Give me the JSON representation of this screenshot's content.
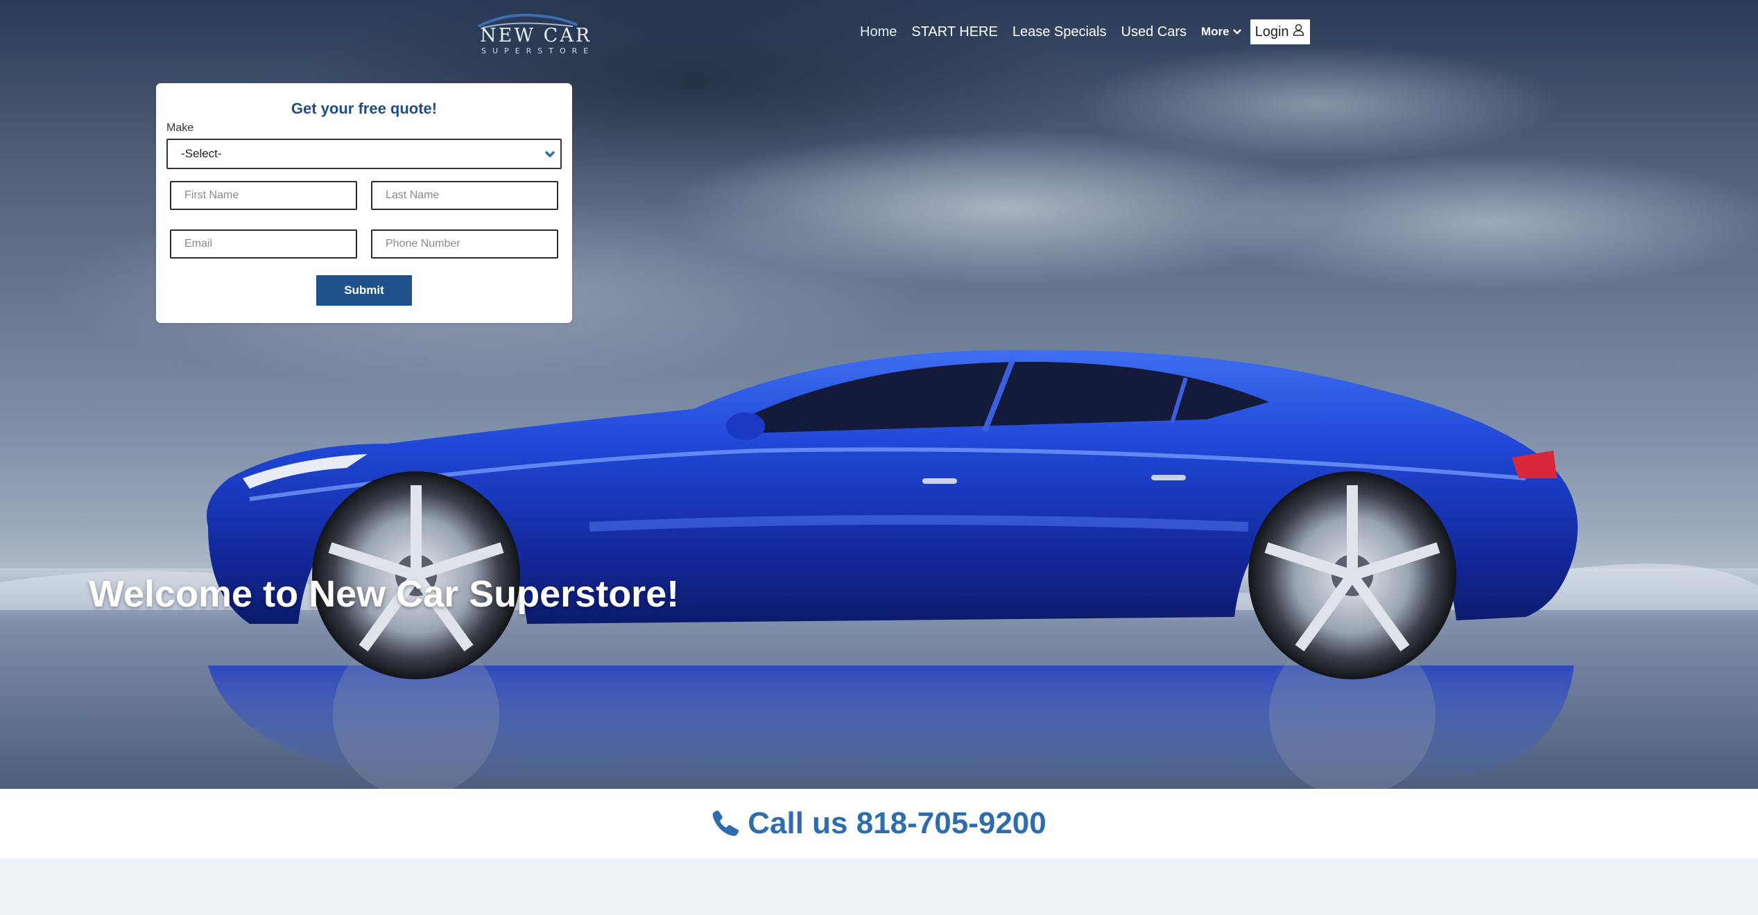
{
  "brand": {
    "logo_line1": "NEW CAR",
    "logo_line2": "SUPERSTORE"
  },
  "nav": {
    "items": [
      {
        "label": "Home"
      },
      {
        "label": "START HERE"
      },
      {
        "label": "Lease Specials"
      },
      {
        "label": "Used Cars"
      }
    ],
    "more_label": "More",
    "login_label": "Login"
  },
  "quote_form": {
    "title": "Get your free quote!",
    "make_label": "Make",
    "make_selected": "-Select-",
    "first_name_placeholder": "First Name",
    "last_name_placeholder": "Last Name",
    "email_placeholder": "Email",
    "phone_placeholder": "Phone Number",
    "submit_label": "Submit"
  },
  "hero": {
    "headline": "Welcome to New Car Superstore!"
  },
  "call": {
    "text": "Call us 818-705-9200"
  },
  "colors": {
    "brand_blue": "#1e5189",
    "title_blue": "#1f4c85",
    "call_blue": "#2d6dad",
    "car_blue": "#1c3fd0"
  },
  "icons": [
    "chevron-down-icon",
    "user-icon",
    "phone-icon"
  ]
}
